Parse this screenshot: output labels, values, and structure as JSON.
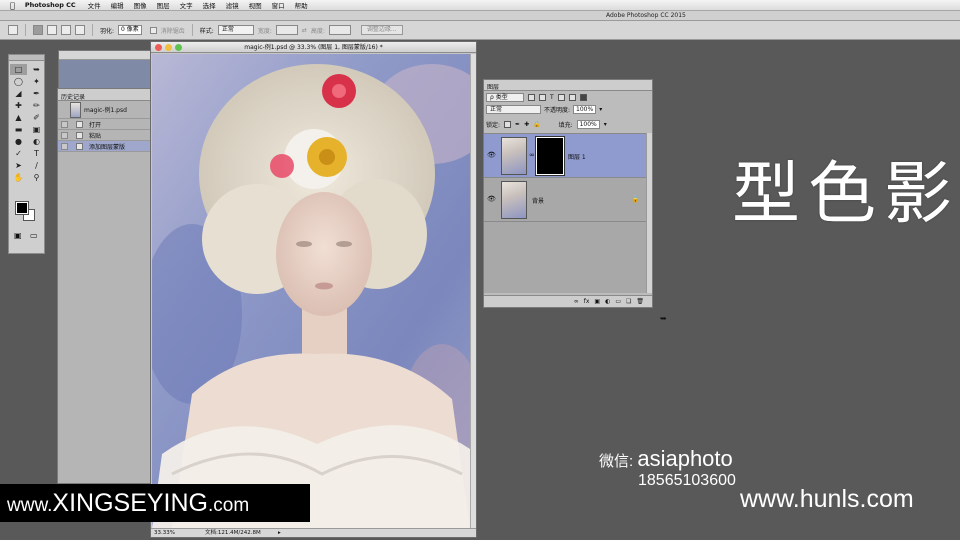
{
  "menubar": {
    "app": "Photoshop CC",
    "items": [
      "文件",
      "编辑",
      "图像",
      "图层",
      "文字",
      "选择",
      "滤镜",
      "视图",
      "窗口",
      "帮助"
    ]
  },
  "app_title": "Adobe Photoshop CC 2015",
  "options": {
    "feather_label": "羽化:",
    "feather_value": "0 像素",
    "antialias_label": "消除锯齿",
    "style_label": "样式:",
    "style_value": "正常",
    "width_label": "宽度:",
    "height_label": "高度:",
    "refine_edge_label": "调整边缘..."
  },
  "history_panel": {
    "title": "历史记录",
    "snapshot_name": "magic-例1.psd",
    "steps": [
      {
        "label": "打开",
        "active": false
      },
      {
        "label": "粘贴",
        "active": false
      },
      {
        "label": "添加图层蒙版",
        "active": true
      }
    ]
  },
  "document": {
    "title": "magic-例1.psd @ 33.3% (图层 1, 图层蒙版/16) *",
    "zoom": "33.33%",
    "doc_size": "文档:121.4M/242.8M"
  },
  "layers_panel": {
    "title": "图层",
    "filter_kind": "ρ 类型",
    "blend_mode": "正常",
    "opacity_label": "不透明度:",
    "opacity_value": "100%",
    "lock_label": "锁定:",
    "fill_label": "填充:",
    "fill_value": "100%",
    "layers": [
      {
        "name": "图层 1",
        "has_mask": true,
        "active": true,
        "locked": false
      },
      {
        "name": "背景",
        "has_mask": false,
        "active": false,
        "locked": true
      }
    ]
  },
  "overlay": {
    "big_title": "型色影",
    "wechat_label": "微信: ",
    "wechat_id": "asiaphoto",
    "phone": "18565103600",
    "site_left_prefix": "www.",
    "site_left_main": "XINGSEYING",
    "site_left_suffix": ".com",
    "site_right": "www.hunls.com"
  },
  "colors": {
    "app_bg": "#595959",
    "selection_highlight": "#8f9bce"
  },
  "icons": {
    "apple": "apple-icon",
    "eye": "eye-icon",
    "lock": "lock-icon"
  }
}
